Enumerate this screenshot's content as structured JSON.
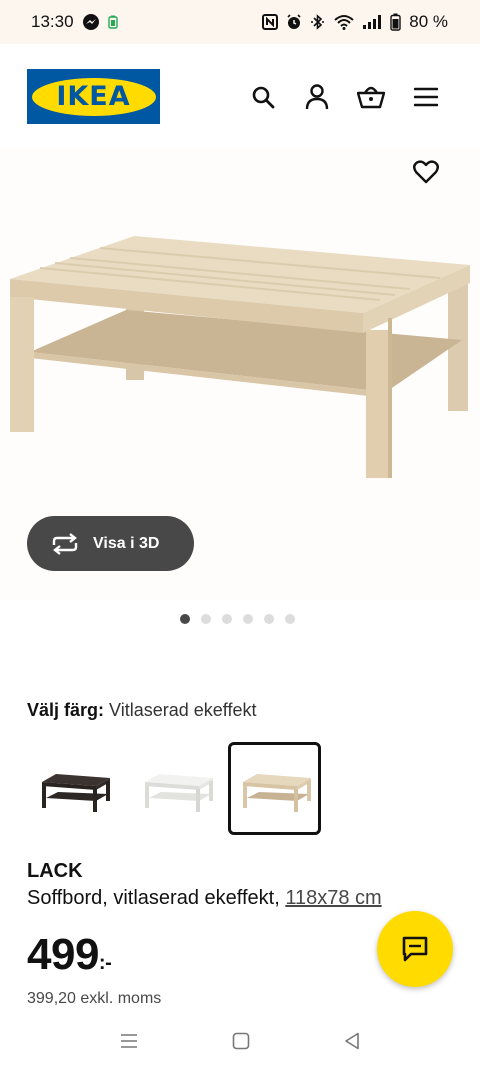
{
  "status": {
    "time": "13:30",
    "battery": "80 %"
  },
  "header": {
    "logo_text": "IKEA",
    "brand_colors": {
      "blue": "#0058a3",
      "yellow": "#ffdb00"
    }
  },
  "gallery": {
    "view_3d_label": "Visa i 3D",
    "dots_total": 6,
    "active_dot": 0
  },
  "product": {
    "color_label": "Välj färg:",
    "color_value": "Vitlaserad ekeffekt",
    "swatches": [
      {
        "name": "black-brown",
        "selected": false
      },
      {
        "name": "white",
        "selected": false
      },
      {
        "name": "white-stained-oak",
        "selected": true
      }
    ],
    "name": "LACK",
    "description": "Soffbord, vitlaserad ekeffekt,",
    "dimensions": "118x78 cm",
    "price_main": "499",
    "price_suffix": ":-",
    "price_excl": "399,20 exkl. moms"
  },
  "icons": [
    "messenger-icon",
    "battery-icon",
    "nfc-icon",
    "alarm-icon",
    "bluetooth-icon",
    "wifi-icon",
    "signal-icon",
    "search-icon",
    "user-icon",
    "cart-icon",
    "menu-icon",
    "heart-icon",
    "rotate-icon",
    "chat-icon"
  ]
}
